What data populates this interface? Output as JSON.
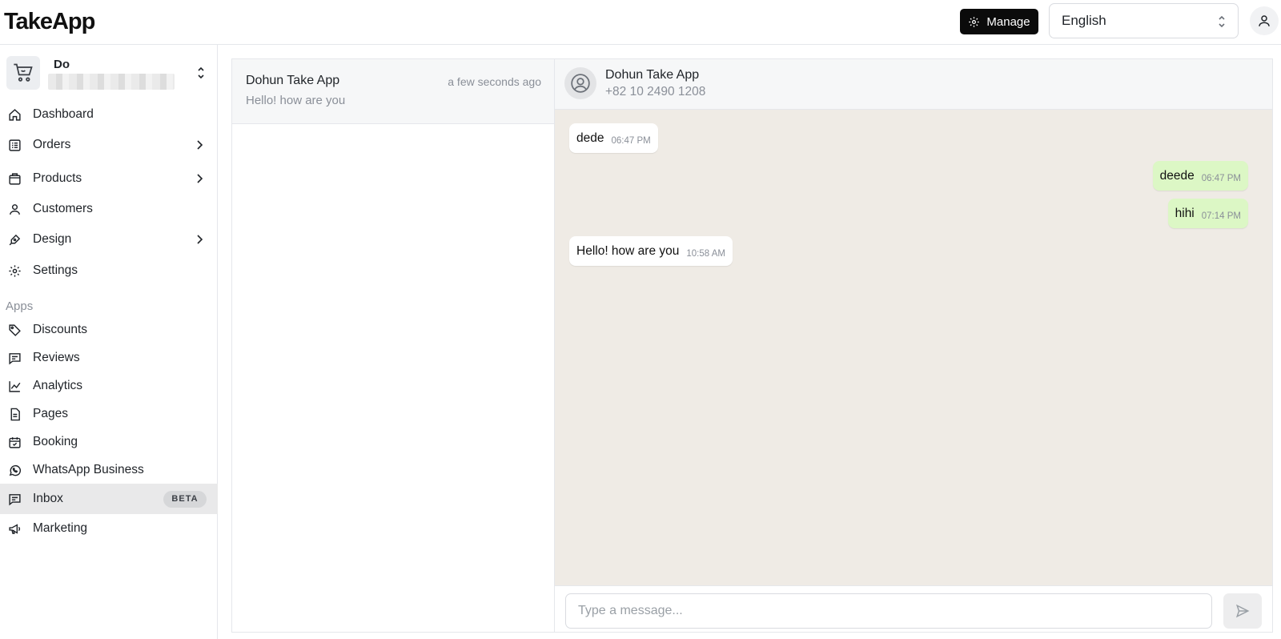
{
  "header": {
    "logo": "TakeApp",
    "manage_label": "Manage",
    "language": "English"
  },
  "store": {
    "name": "Do"
  },
  "nav": {
    "items": [
      {
        "label": "Dashboard",
        "icon": "home-icon"
      },
      {
        "label": "Orders",
        "icon": "orders-icon"
      },
      {
        "label": "Products",
        "icon": "products-icon"
      },
      {
        "label": "Customers",
        "icon": "customers-icon"
      },
      {
        "label": "Design",
        "icon": "design-icon"
      },
      {
        "label": "Settings",
        "icon": "gear-icon"
      }
    ],
    "apps_label": "Apps",
    "apps": [
      {
        "label": "Discounts",
        "icon": "tag-icon"
      },
      {
        "label": "Reviews",
        "icon": "reviews-icon"
      },
      {
        "label": "Analytics",
        "icon": "analytics-icon"
      },
      {
        "label": "Pages",
        "icon": "pages-icon"
      },
      {
        "label": "Booking",
        "icon": "calendar-icon"
      },
      {
        "label": "WhatsApp Business",
        "icon": "whatsapp-icon"
      },
      {
        "label": "Inbox",
        "icon": "inbox-icon",
        "badge": "BETA"
      },
      {
        "label": "Marketing",
        "icon": "megaphone-icon"
      }
    ]
  },
  "conversations": [
    {
      "name": "Dohun Take App",
      "time": "a few seconds ago",
      "preview": "Hello! how are you"
    }
  ],
  "chat": {
    "contact_name": "Dohun Take App",
    "contact_phone": "+82 10 2490 1208",
    "messages": [
      {
        "text": "dede",
        "time": "06:47 PM",
        "direction": "in"
      },
      {
        "text": "deede",
        "time": "06:47 PM",
        "direction": "out"
      },
      {
        "text": "hihi",
        "time": "07:14 PM",
        "direction": "out"
      },
      {
        "text": "Hello! how are you",
        "time": "10:58 AM",
        "direction": "in"
      }
    ],
    "input_placeholder": "Type a message..."
  },
  "colors": {
    "chat_background": "#efebe5",
    "outgoing_bubble": "#dcf7c5",
    "incoming_bubble": "#ffffff",
    "active_nav": "#e9e9ea"
  }
}
